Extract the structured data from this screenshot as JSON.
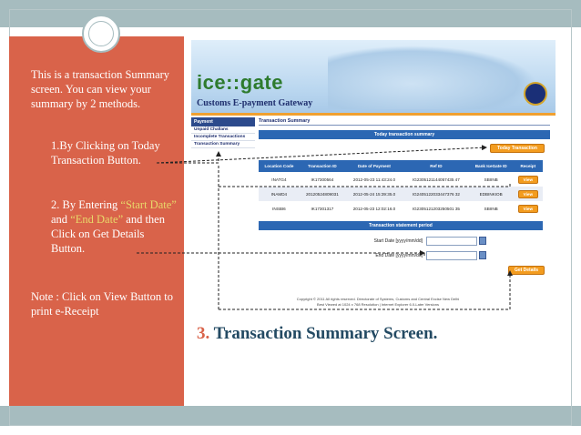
{
  "slide": {
    "notes": {
      "intro": "This is a transaction Summary screen. You can view your summary by 2 methods.",
      "method1": "1.By Clicking on Today Transaction Button.",
      "method2_pre": "2. By Entering ",
      "method2_start": "“Start Date”",
      "method2_and": " and ",
      "method2_end": "“End Date”",
      "method2_post": " and then Click on Get Details Button.",
      "note": "Note : Click on View Button to print e-Receipt"
    },
    "heading_number": "3.",
    "heading_text": "Transaction Summary Screen.",
    "colors": {
      "panel": "#d9634a",
      "bars": "#a6bcbf",
      "heading": "#234a63",
      "highlight": "#e8d86a"
    }
  },
  "portal": {
    "logo_ice": "ice",
    "logo_sep": "::",
    "logo_gate": "gate",
    "tagline": "Customs E-payment Gateway",
    "sidebar": {
      "header": "Payment",
      "items": [
        "Unpaid Challans",
        "Incomplete Transactions",
        "Transaction Summary"
      ]
    },
    "page_title": "Transaction Summary",
    "today_bar": "Today transaction summary",
    "today_button": "Today Transaction",
    "table": {
      "columns": [
        "Location Code",
        "Transaction ID",
        "Date of Payment",
        "Ref ID",
        "Bank IceGate ID",
        "Receipt"
      ],
      "rows": [
        [
          "INATG4",
          "IK17300564",
          "2012-05-23 11:43:24.0",
          "IG2305121144057435 47",
          "SBIINB",
          "View"
        ],
        [
          "INAMD4",
          "20120524809031",
          "2012-05-24 15:39:35.0",
          "IG2405122033447376 32",
          "EDBINKIOB",
          "View"
        ],
        [
          "INSBI6",
          "IK17301317",
          "2012-05-23 12:02:16.0",
          "IG2305121203250501 35",
          "SBIINB",
          "View"
        ]
      ]
    },
    "period_bar": "Transaction statement period",
    "start_label": "Start Date [yyyy/mm/dd]",
    "end_label": "End Date [yyyy/mm/dd]",
    "get_details": "Get Details",
    "footer_line1": "Copyright © 2011 All rights reserved. Directorate of Systems, Customs and Central Excise New Delhi",
    "footer_line2": "Best Viewed at 1024 x 768 Resolution | Internet Explorer 6.0-Later Versions"
  }
}
